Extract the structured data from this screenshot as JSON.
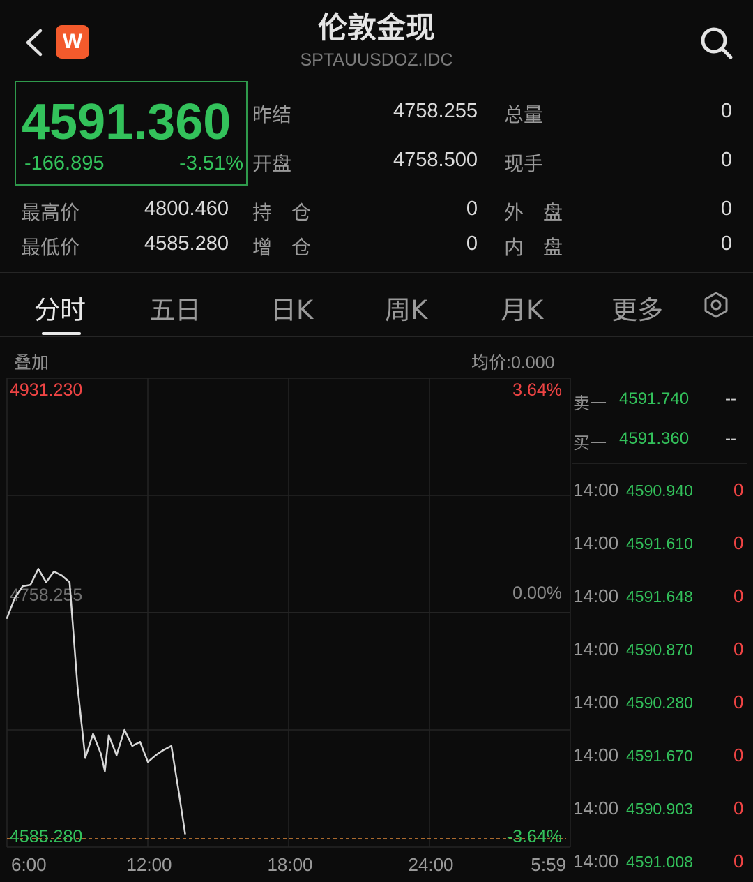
{
  "header": {
    "title": "伦敦金现",
    "subtitle": "SPTAUUSDOZ.IDC",
    "logo_text": "W"
  },
  "quote": {
    "last_price": "4591.360",
    "change": "-166.895",
    "change_pct": "-3.51%"
  },
  "stats": [
    {
      "label": "昨结",
      "value": "4758.255"
    },
    {
      "label": "总量",
      "value": "0"
    },
    {
      "label": "开盘",
      "value": "4758.500"
    },
    {
      "label": "现手",
      "value": "0"
    },
    {
      "label": "最高价",
      "value": "4800.460"
    },
    {
      "label": "持　仓",
      "value": "0"
    },
    {
      "label": "外　盘",
      "value": "0"
    },
    {
      "label": "最低价",
      "value": "4585.280"
    },
    {
      "label": "增　仓",
      "value": "0"
    },
    {
      "label": "内　盘",
      "value": "0"
    }
  ],
  "tabs": [
    "分时",
    "五日",
    "日K",
    "周K",
    "月K",
    "更多"
  ],
  "active_tab": "分时",
  "chart": {
    "overlay_label": "叠加",
    "avg_price_label": "均价:0.000",
    "y_top": "4931.230",
    "y_mid": "4758.255",
    "y_bottom": "4585.280",
    "pct_top": "3.64%",
    "pct_mid": "0.00%",
    "pct_bottom": "-3.64%",
    "x_labels": [
      "6:00",
      "12:00",
      "18:00",
      "24:00",
      "5:59"
    ]
  },
  "chart_data": {
    "type": "line",
    "ylim": [
      4585.28,
      4931.23
    ],
    "reference_price": 4758.255,
    "series": [
      {
        "x": [
          "06:00",
          "06:20",
          "06:40",
          "07:00",
          "07:20",
          "07:40",
          "08:00",
          "08:20",
          "08:40",
          "09:00",
          "09:20",
          "09:40",
          "10:00",
          "10:10",
          "10:20",
          "10:40",
          "11:00",
          "11:20",
          "11:40",
          "12:00",
          "12:20",
          "12:40",
          "13:00",
          "13:20",
          "13:35"
        ],
        "values": [
          4751,
          4766,
          4775,
          4776,
          4788,
          4778,
          4786,
          4783,
          4778,
          4700,
          4646,
          4664,
          4649,
          4636,
          4663,
          4648,
          4667,
          4655,
          4658,
          4643,
          4648,
          4652,
          4655,
          4618,
          4589
        ]
      }
    ],
    "grid": true
  },
  "order_book": {
    "ask_label": "卖一",
    "ask_price": "4591.740",
    "ask_vol": "--",
    "bid_label": "买一",
    "bid_price": "4591.360",
    "bid_vol": "--"
  },
  "trades": [
    {
      "time": "14:00",
      "price": "4590.940",
      "vol": "0"
    },
    {
      "time": "14:00",
      "price": "4591.610",
      "vol": "0"
    },
    {
      "time": "14:00",
      "price": "4591.648",
      "vol": "0"
    },
    {
      "time": "14:00",
      "price": "4590.870",
      "vol": "0"
    },
    {
      "time": "14:00",
      "price": "4590.280",
      "vol": "0"
    },
    {
      "time": "14:00",
      "price": "4591.670",
      "vol": "0"
    },
    {
      "time": "14:00",
      "price": "4590.903",
      "vol": "0"
    },
    {
      "time": "14:00",
      "price": "4591.008",
      "vol": "0"
    }
  ],
  "colors": {
    "up": "#ef4444",
    "down": "#33c25b",
    "line": "#d8d8d8",
    "background": "#0c0c0c"
  }
}
